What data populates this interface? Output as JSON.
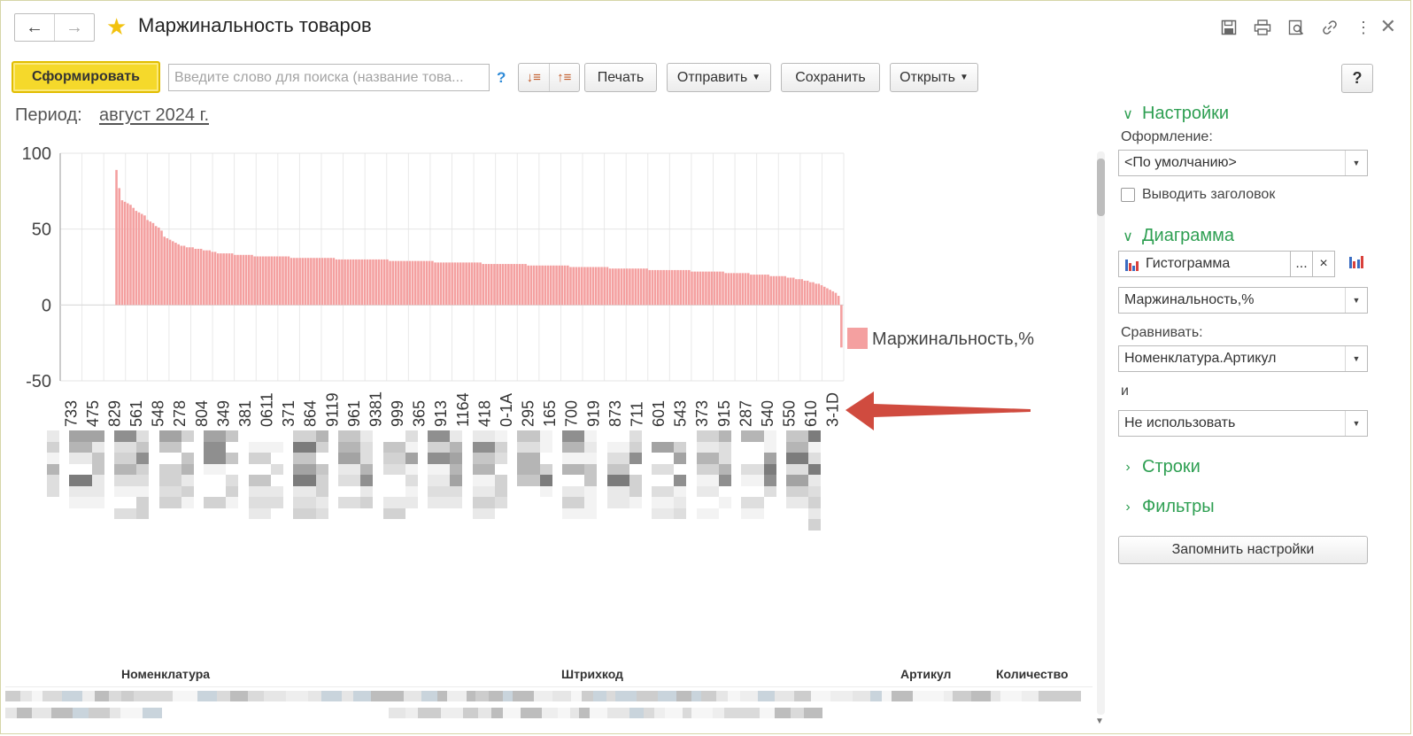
{
  "window": {
    "title": "Маржинальность товаров"
  },
  "nav": {
    "back_icon": "arrow-left-icon",
    "forward_icon": "arrow-right-icon"
  },
  "titlebar_icons": [
    "save-icon",
    "print-icon",
    "preview-icon",
    "link-icon",
    "more-icon"
  ],
  "toolbar": {
    "generate_label": "Сформировать",
    "search_placeholder": "Введите слово для поиска (название това...",
    "search_help": "?",
    "print_label": "Печать",
    "send_label": "Отправить",
    "save_label": "Сохранить",
    "open_label": "Открыть",
    "help_label": "?"
  },
  "period": {
    "label": "Период:",
    "value": "август 2024 г."
  },
  "chart_data": {
    "type": "bar",
    "ylim": [
      -50,
      100
    ],
    "yticks": [
      100,
      50,
      0,
      -50
    ],
    "legend": "Маржинальность,%",
    "x_tick_labels": [
      "733",
      "475",
      "829",
      "561",
      "548",
      "278",
      "804",
      "349",
      "381",
      "0611",
      "371",
      "864",
      "9119",
      "961",
      "9381",
      "999",
      "365",
      "913",
      "1164",
      "418",
      "0-1A",
      "295",
      "165",
      "700",
      "919",
      "873",
      "711",
      "601",
      "543",
      "373",
      "915",
      "287",
      "540",
      "550",
      "610",
      "3-1D"
    ],
    "series": [
      {
        "name": "Маржинальность,%",
        "color": "#f4a0a0",
        "values": [
          89,
          77,
          69,
          68,
          67,
          66,
          64,
          62,
          61,
          60,
          59,
          56,
          55,
          54,
          52,
          51,
          49,
          45,
          44,
          43,
          42,
          41,
          40,
          39,
          39,
          38,
          38,
          38,
          37,
          37,
          37,
          36,
          36,
          36,
          35,
          35,
          34,
          34,
          34,
          34,
          34,
          34,
          33,
          33,
          33,
          33,
          33,
          33,
          33,
          32,
          32,
          32,
          32,
          32,
          32,
          32,
          32,
          32,
          32,
          32,
          32,
          32,
          31,
          31,
          31,
          31,
          31,
          31,
          31,
          31,
          31,
          31,
          31,
          31,
          31,
          31,
          31,
          31,
          30,
          30,
          30,
          30,
          30,
          30,
          30,
          30,
          30,
          30,
          30,
          30,
          30,
          30,
          30,
          30,
          30,
          30,
          30,
          29,
          29,
          29,
          29,
          29,
          29,
          29,
          29,
          29,
          29,
          29,
          29,
          29,
          29,
          29,
          29,
          28,
          28,
          28,
          28,
          28,
          28,
          28,
          28,
          28,
          28,
          28,
          28,
          28,
          28,
          28,
          28,
          28,
          27,
          27,
          27,
          27,
          27,
          27,
          27,
          27,
          27,
          27,
          27,
          27,
          27,
          27,
          27,
          27,
          26,
          26,
          26,
          26,
          26,
          26,
          26,
          26,
          26,
          26,
          26,
          26,
          26,
          26,
          26,
          25,
          25,
          25,
          25,
          25,
          25,
          25,
          25,
          25,
          25,
          25,
          25,
          25,
          25,
          24,
          24,
          24,
          24,
          24,
          24,
          24,
          24,
          24,
          24,
          24,
          24,
          24,
          24,
          23,
          23,
          23,
          23,
          23,
          23,
          23,
          23,
          23,
          23,
          23,
          23,
          23,
          23,
          23,
          22,
          22,
          22,
          22,
          22,
          22,
          22,
          22,
          22,
          22,
          22,
          22,
          21,
          21,
          21,
          21,
          21,
          21,
          21,
          21,
          21,
          20,
          20,
          20,
          20,
          20,
          20,
          20,
          19,
          19,
          19,
          19,
          19,
          19,
          18,
          18,
          18,
          17,
          17,
          17,
          16,
          16,
          15,
          15,
          14,
          14,
          13,
          12,
          11,
          10,
          9,
          8,
          6,
          -28
        ]
      }
    ]
  },
  "table": {
    "headers": [
      "Номенклатура",
      "Штрихкод",
      "Артикул",
      "Количество"
    ]
  },
  "settings": {
    "section_settings": "Настройки",
    "design_label": "Оформление:",
    "design_value": "<По умолчанию>",
    "show_header_label": "Выводить заголовок",
    "section_chart": "Диаграмма",
    "chart_type_value": "Гистограмма",
    "chart_type_more": "...",
    "chart_type_clear": "×",
    "measure_value": "Маржинальность,%",
    "compare_label": "Сравнивать:",
    "compare_value": "Номенклатура.Артикул",
    "and_label": "и",
    "and_value": "Не использовать",
    "section_rows": "Строки",
    "section_filters": "Фильтры",
    "remember_label": "Запомнить настройки"
  },
  "colors": {
    "accent": "#2e9f52",
    "primary_button": "#f5d92b",
    "bar": "#f4a0a0",
    "arrow": "#d04b3f"
  }
}
